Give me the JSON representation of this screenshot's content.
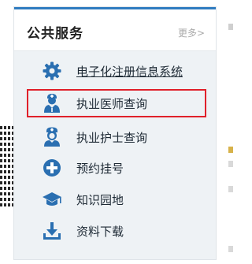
{
  "panel": {
    "title": "公共服务",
    "more_label": "更多>"
  },
  "services": [
    {
      "id": "einfo",
      "label": "电子化注册信息系统",
      "icon": "gear-icon",
      "underlined": true,
      "highlighted": false
    },
    {
      "id": "doctor",
      "label": "执业医师查询",
      "icon": "doctor-icon",
      "underlined": false,
      "highlighted": true
    },
    {
      "id": "nurse",
      "label": "执业护士查询",
      "icon": "nurse-icon",
      "underlined": false,
      "highlighted": false
    },
    {
      "id": "appointment",
      "label": "预约挂号",
      "icon": "medical-cross-icon",
      "underlined": false,
      "highlighted": false
    },
    {
      "id": "knowledge",
      "label": "知识园地",
      "icon": "graduation-cap-icon",
      "underlined": false,
      "highlighted": false
    },
    {
      "id": "download",
      "label": "资料下载",
      "icon": "download-icon",
      "underlined": false,
      "highlighted": false
    }
  ],
  "colors": {
    "accent": "#2f7cc0",
    "icon": "#2a6fb1",
    "highlight_border": "#e0202a",
    "card_bg": "#eef2f5"
  }
}
